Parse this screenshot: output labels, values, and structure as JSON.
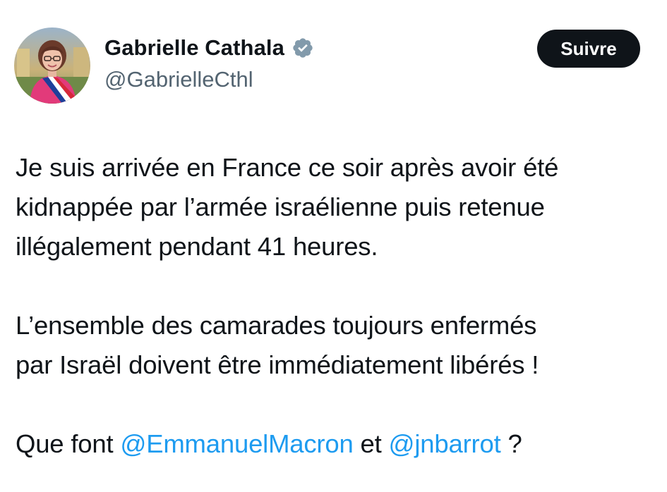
{
  "author": {
    "display_name": "Gabrielle Cathala",
    "handle": "@GabrielleCthl",
    "verified_icon": "verified-badge-icon",
    "avatar_icon": "profile-avatar"
  },
  "follow_button": {
    "label": "Suivre"
  },
  "tweet": {
    "line1": "Je suis arrivée en France ce soir après avoir été",
    "line2": "kidnappée par l’armée israélienne puis retenue",
    "line3": "illégalement pendant 41 heures.",
    "line4": "L’ensemble des camarades toujours enfermés",
    "line5": "par Israël doivent être immédiatement libérés !",
    "line6_prefix": "Que font ",
    "mention1": "@EmmanuelMacron",
    "line6_mid": " et ",
    "mention2": "@jnbarrot",
    "line6_suffix": " ?"
  },
  "colors": {
    "text": "#0f1419",
    "secondary_text": "#536471",
    "link": "#1d9bf0",
    "button_bg": "#0f1419",
    "button_text": "#ffffff",
    "verified": "#829aab"
  }
}
